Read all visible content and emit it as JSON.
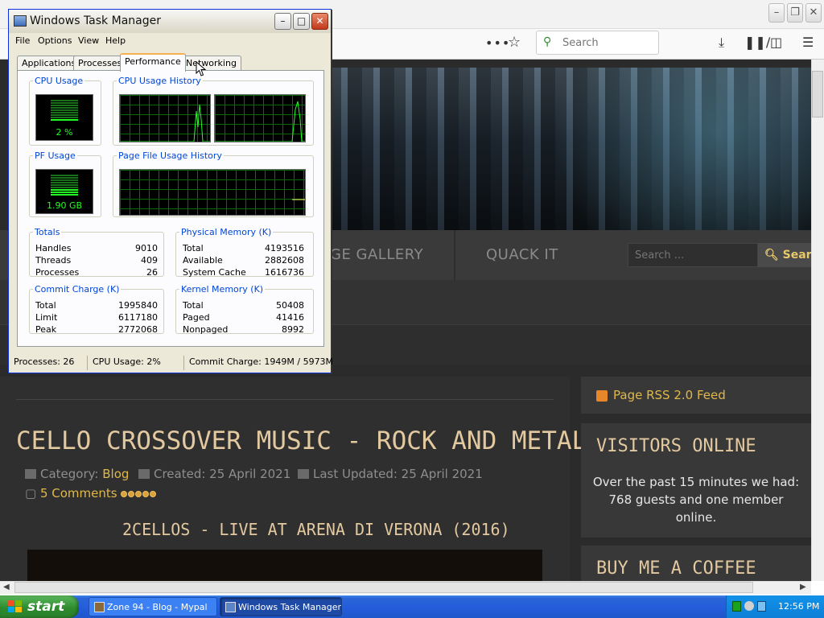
{
  "browser": {
    "toolbar": {
      "overflow_icon": "ellipsis-icon",
      "bookmark_icon": "star-icon",
      "search_placeholder": "Search",
      "download_icon": "download-arrow-icon",
      "library_icon": "library-icon",
      "sidebar_icon": "sidebar-icon",
      "menu_icon": "hamburger-menu-icon"
    }
  },
  "site": {
    "nav": [
      "GE GALLERY",
      "QUACK IT"
    ],
    "search_placeholder": "Search ...",
    "search_button": "Search",
    "article": {
      "title": "CELLO CROSSOVER MUSIC - ROCK AND METAL",
      "category_label": "Category:",
      "category_link": "Blog",
      "created": "Created: 25 April 2021",
      "updated": "Last Updated: 25 April 2021",
      "comments": "5 Comments",
      "rating_stars": 5,
      "video_title": "2CELLOS - LIVE AT ARENA DI VERONA (2016)"
    },
    "sidebar": {
      "rss": "Page RSS 2.0 Feed",
      "visitors_heading": "VISITORS ONLINE",
      "visitors_text": "Over the past 15 minutes we had: 768 guests and one member online.",
      "coffee_heading": "BUY ME A COFFEE"
    }
  },
  "taskmgr": {
    "title": "Windows Task Manager",
    "menu": [
      "File",
      "Options",
      "View",
      "Help"
    ],
    "tabs": [
      "Applications",
      "Processes",
      "Performance",
      "Networking"
    ],
    "active_tab": "Performance",
    "cpu_usage": {
      "label": "CPU Usage",
      "value": "2 %",
      "level": 0.02
    },
    "cpu_history_label": "CPU Usage History",
    "pf_usage": {
      "label": "PF Usage",
      "value": "1.90 GB",
      "level": 0.32
    },
    "pf_history_label": "Page File Usage History",
    "totals": {
      "label": "Totals",
      "rows": [
        {
          "k": "Handles",
          "v": "9010"
        },
        {
          "k": "Threads",
          "v": "409"
        },
        {
          "k": "Processes",
          "v": "26"
        }
      ]
    },
    "physical_memory": {
      "label": "Physical Memory (K)",
      "rows": [
        {
          "k": "Total",
          "v": "4193516"
        },
        {
          "k": "Available",
          "v": "2882608"
        },
        {
          "k": "System Cache",
          "v": "1616736"
        }
      ]
    },
    "commit_charge": {
      "label": "Commit Charge (K)",
      "rows": [
        {
          "k": "Total",
          "v": "1995840"
        },
        {
          "k": "Limit",
          "v": "6117180"
        },
        {
          "k": "Peak",
          "v": "2772068"
        }
      ]
    },
    "kernel_memory": {
      "label": "Kernel Memory (K)",
      "rows": [
        {
          "k": "Total",
          "v": "50408"
        },
        {
          "k": "Paged",
          "v": "41416"
        },
        {
          "k": "Nonpaged",
          "v": "8992"
        }
      ]
    },
    "status": {
      "processes": "Processes: 26",
      "cpu": "CPU Usage: 2%",
      "commit": "Commit Charge: 1949M / 5973M"
    }
  },
  "taskbar": {
    "start": "start",
    "tasks": [
      "Zone 94 - Blog - Mypal",
      "Windows Task Manager"
    ],
    "clock": "12:56 PM"
  },
  "colors": {
    "accent_gold": "#e0b84a",
    "title_cream": "#e3c9a0",
    "xp_blue": "#245edb",
    "meter_green": "#22ff22"
  }
}
